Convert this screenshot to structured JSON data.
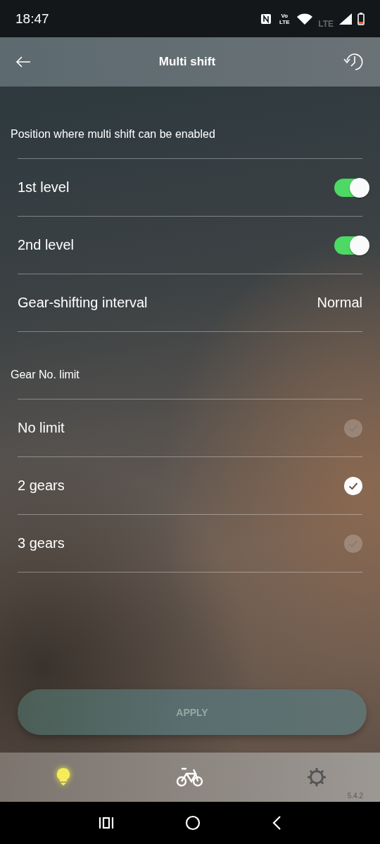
{
  "status_bar": {
    "time": "18:47",
    "volte": "Vo LTE",
    "network": "LTE"
  },
  "app_bar": {
    "title": "Multi shift"
  },
  "sections": [
    {
      "header": "Position where multi shift can be enabled",
      "rows": [
        {
          "kind": "toggle",
          "label": "1st level",
          "on": true
        },
        {
          "kind": "toggle",
          "label": "2nd level",
          "on": true
        },
        {
          "kind": "value",
          "label": "Gear-shifting interval",
          "value": "Normal"
        }
      ]
    },
    {
      "header": "Gear No. limit",
      "rows": [
        {
          "kind": "choice",
          "label": "No limit",
          "selected": false
        },
        {
          "kind": "choice",
          "label": "2 gears",
          "selected": true
        },
        {
          "kind": "choice",
          "label": "3 gears",
          "selected": false
        }
      ]
    }
  ],
  "apply_button": {
    "label": "APPLY",
    "disabled": true
  },
  "bottom_nav": {
    "items": [
      {
        "kind": "bulb",
        "selected": true
      },
      {
        "kind": "bike",
        "selected": false
      },
      {
        "kind": "gear",
        "selected": false
      }
    ],
    "version": "5.4.2"
  }
}
